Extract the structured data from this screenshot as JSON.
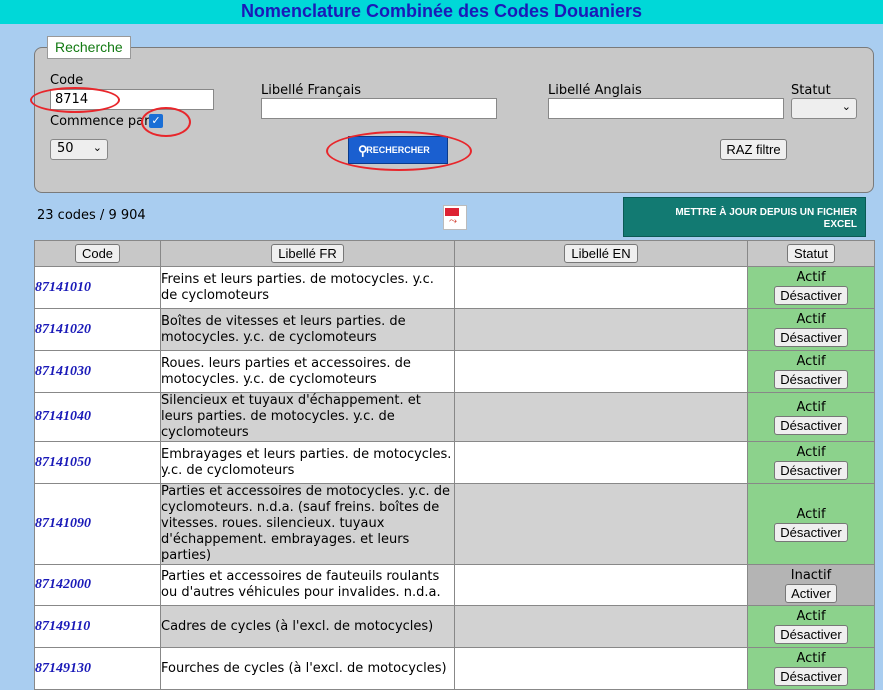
{
  "header": {
    "title": "Nomenclature Combinée des Codes Douaniers"
  },
  "search": {
    "legend": "Recherche",
    "code_label": "Code",
    "code_value": "8714",
    "starts_with_label": "Commence par",
    "starts_with_checked": true,
    "fr_label": "Libellé Français",
    "fr_value": "",
    "en_label": "Libellé Anglais",
    "en_value": "",
    "status_label": "Statut",
    "status_value": "",
    "page_size": "50",
    "search_button": "RECHERCHER",
    "reset_button": "RAZ filtre"
  },
  "summary": {
    "count_text": "23 codes / 9 904"
  },
  "excel_button": {
    "line1": "METTRE À JOUR DEPUIS UN FICHIER",
    "line2": "EXCEL"
  },
  "icons": {
    "pdf": "pdf-file-icon",
    "search": "magnifier-icon",
    "checkbox": "checkmark-icon"
  },
  "colors": {
    "header_bg": "#00d8d8",
    "title": "#1a1ab8",
    "active": "#8cd28c",
    "inactive": "#b4b4b4",
    "excel": "#127a72",
    "search_btn": "#1a5fd0",
    "highlight_ring": "#e8262b"
  },
  "table": {
    "headers": {
      "code": "Code",
      "fr": "Libellé FR",
      "en": "Libellé EN",
      "statut": "Statut"
    },
    "rows": [
      {
        "code": "87141010",
        "fr": "Freins et leurs parties. de motocycles. y.c. de cyclomoteurs",
        "en": "",
        "status": "Actif",
        "action": "Désactiver",
        "active": true
      },
      {
        "code": "87141020",
        "fr": "Boîtes de vitesses et leurs parties. de motocycles. y.c. de cyclomoteurs",
        "en": "",
        "status": "Actif",
        "action": "Désactiver",
        "active": true
      },
      {
        "code": "87141030",
        "fr": "Roues. leurs parties et accessoires. de motocycles. y.c. de cyclomoteurs",
        "en": "",
        "status": "Actif",
        "action": "Désactiver",
        "active": true
      },
      {
        "code": "87141040",
        "fr": "Silencieux et tuyaux d'échappement. et leurs parties. de motocycles. y.c. de cyclomoteurs",
        "en": "",
        "status": "Actif",
        "action": "Désactiver",
        "active": true
      },
      {
        "code": "87141050",
        "fr": "Embrayages et leurs parties. de motocycles. y.c. de cyclomoteurs",
        "en": "",
        "status": "Actif",
        "action": "Désactiver",
        "active": true
      },
      {
        "code": "87141090",
        "fr": "Parties et accessoires de motocycles. y.c. de cyclomoteurs. n.d.a. (sauf freins. boîtes de vitesses. roues. silencieux. tuyaux d'échappement. embrayages. et leurs parties)",
        "en": "",
        "status": "Actif",
        "action": "Désactiver",
        "active": true
      },
      {
        "code": "87142000",
        "fr": "Parties et accessoires de fauteuils roulants ou d'autres véhicules pour invalides. n.d.a.",
        "en": "",
        "status": "Inactif",
        "action": "Activer",
        "active": false
      },
      {
        "code": "87149110",
        "fr": "Cadres de cycles (à l'excl. de motocycles)",
        "en": "",
        "status": "Actif",
        "action": "Désactiver",
        "active": true
      },
      {
        "code": "87149130",
        "fr": "Fourches de cycles (à l'excl. de motocycles)",
        "en": "",
        "status": "Actif",
        "action": "Désactiver",
        "active": true
      }
    ]
  }
}
